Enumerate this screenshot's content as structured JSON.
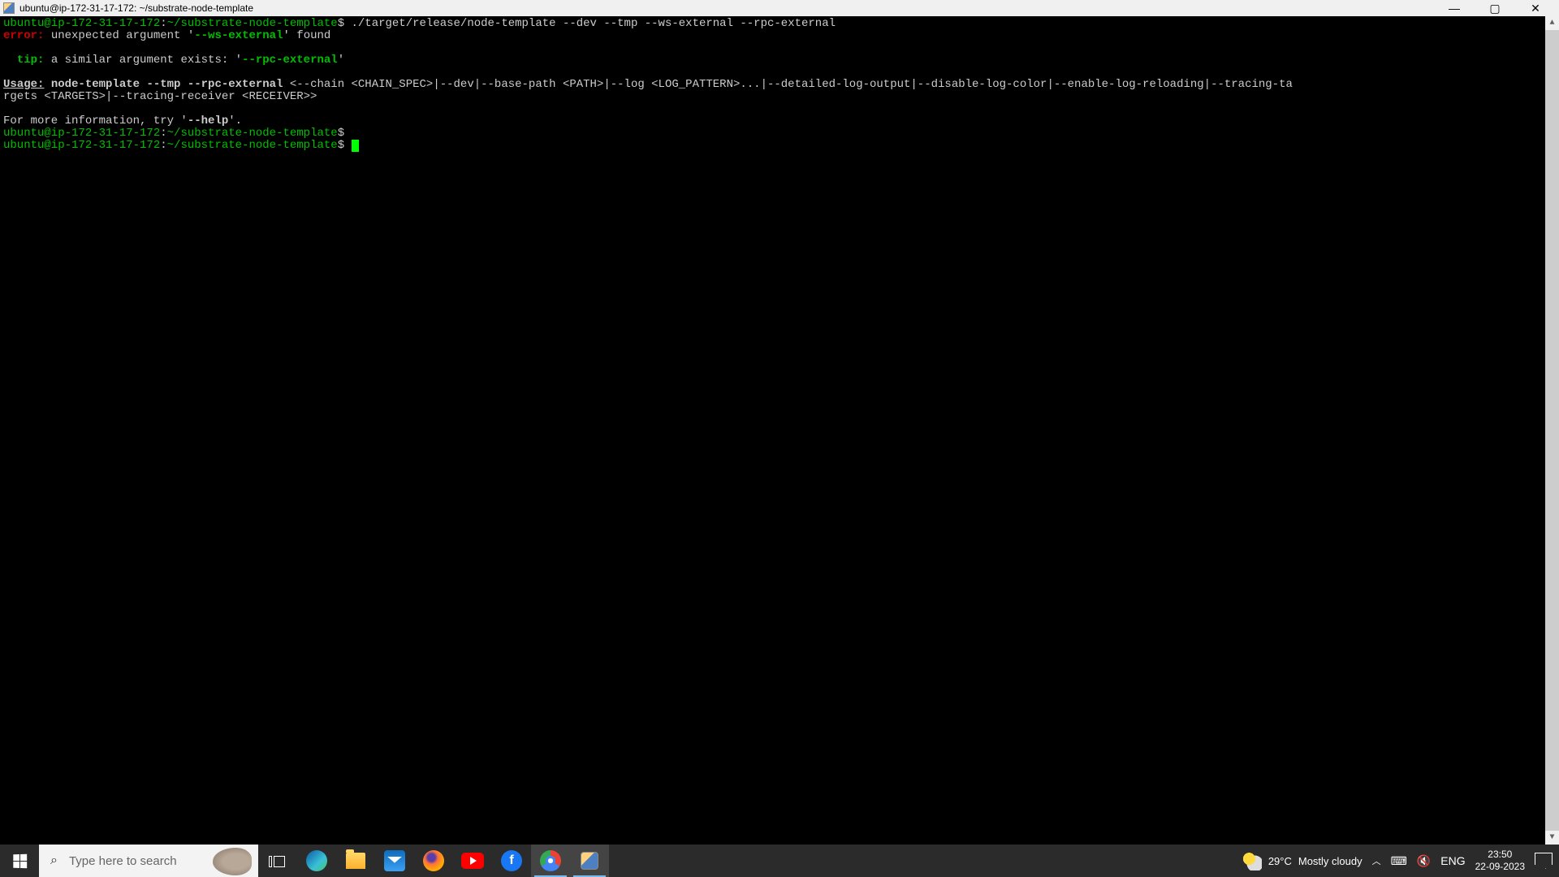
{
  "window": {
    "title": "ubuntu@ip-172-31-17-172: ~/substrate-node-template"
  },
  "terminal": {
    "prompt_user": "ubuntu@ip-172-31-17-172",
    "prompt_path": "~/substrate-node-template",
    "prompt_sep": ":",
    "prompt_end": "$",
    "command": "./target/release/node-template --dev --tmp --ws-external --rpc-external",
    "error_label": "error:",
    "error_text_1": " unexpected argument '",
    "error_arg": "--ws-external",
    "error_text_2": "' found",
    "tip_label": "tip:",
    "tip_text_1": " a similar argument exists: '",
    "tip_arg": "--rpc-external",
    "tip_text_2": "'",
    "usage_label": "Usage:",
    "usage_cmd": " node-template --tmp --rpc-external",
    "usage_rest": " <--chain <CHAIN_SPEC>|--dev|--base-path <PATH>|--log <LOG_PATTERN>...|--detailed-log-output|--disable-log-color|--enable-log-reloading|--tracing-ta\nrgets <TARGETS>|--tracing-receiver <RECEIVER>>",
    "help_line_1": "For more information, try '",
    "help_flag": "--help",
    "help_line_2": "'."
  },
  "taskbar": {
    "search_placeholder": "Type here to search",
    "weather_temp": "29°C",
    "weather_desc": "Mostly cloudy",
    "lang": "ENG",
    "time": "23:50",
    "date": "22-09-2023"
  }
}
